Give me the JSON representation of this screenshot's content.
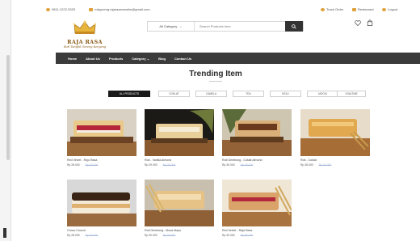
{
  "topbar": {
    "phone": "0811-1222-3333",
    "email": "rotigoreng.rajarasamuslim@gmail.com",
    "track_order": "Track Order",
    "restaurant": "Restaurant",
    "login": "Logout"
  },
  "brand": {
    "name": "RAJA RASA",
    "tagline": "Roti Tangkil Goreng Kenyang"
  },
  "search": {
    "category_label": "All Category",
    "placeholder": "Search Products here"
  },
  "nav": {
    "items": [
      "Home",
      "About Us",
      "Products",
      "Category",
      "Blog",
      "Contact Us"
    ]
  },
  "section": {
    "title": "Trending Item"
  },
  "filters": [
    "ALL PRODUCTS",
    "COKLAT",
    "CAMELA",
    "TEA",
    "KEJU",
    "MOCHI",
    "OVALTINE"
  ],
  "products": [
    {
      "name": "Red Velvet - Rojo Rasa",
      "price": "Rp 28.000",
      "original": "Rp 30.000"
    },
    {
      "name": "Roti - Vanilla Almond",
      "price": "Rp 29.000",
      "original": "Rp 30.000"
    },
    {
      "name": "Roti Gembong - Coklat Almond",
      "price": "Rp 30.000",
      "original": "Rp 35.000"
    },
    {
      "name": "Roti - Coklat",
      "price": "Rp 28.000",
      "original": "Rp 30.000"
    },
    {
      "name": "Choco Crunch",
      "price": "Rp 28.000",
      "original": "Rp 30.000"
    },
    {
      "name": "Roti Gembong - Moca Mayo",
      "price": "Rp 30.000",
      "original": "Rp 35.000"
    },
    {
      "name": "Red Velvet - Raja Rasa",
      "price": "Rp 40.000",
      "original": "Rp 50.000"
    }
  ],
  "colors": {
    "nav_bg": "#3b3b3b",
    "accent": "#e0a13a",
    "brand": "#8a5a14",
    "old_price": "#a8b8d8"
  }
}
